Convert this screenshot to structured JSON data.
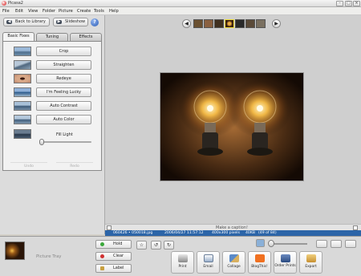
{
  "window": {
    "title": "Picasa2"
  },
  "menu": [
    "File",
    "Edit",
    "View",
    "Folder",
    "Picture",
    "Create",
    "Tools",
    "Help"
  ],
  "nav": {
    "back_label": "Back to Library",
    "slideshow_label": "Slideshow",
    "help_label": "?"
  },
  "tabs": [
    "Basic Fixes",
    "Tuning",
    "Effects"
  ],
  "fixes": [
    "Crop",
    "Straighten",
    "Redeye",
    "I'm Feeling Lucky",
    "Auto Contrast",
    "Auto Color"
  ],
  "fill_light": {
    "label": "Fill Light",
    "value": 0
  },
  "edit_history": {
    "undo_label": "Undo",
    "redo_label": "Redo"
  },
  "caption": {
    "placeholder": "Make a caption!"
  },
  "status": {
    "filename": "060426 • 050018.jpg",
    "date": "2006/04/27 11:57:12",
    "dimensions": "400x300 pixels",
    "size": "40KB",
    "position": "(49 of 84)"
  },
  "tray": {
    "label": "Picture Tray",
    "hold_label": "Hold",
    "clear_label": "Clear",
    "label_label": "Label"
  },
  "actions": [
    "Print",
    "Email",
    "Collage",
    "BlogThis!",
    "Order Prints",
    "Export"
  ],
  "colors": {
    "status_bar": "#2c65a8",
    "background": "#d4d0c8"
  }
}
